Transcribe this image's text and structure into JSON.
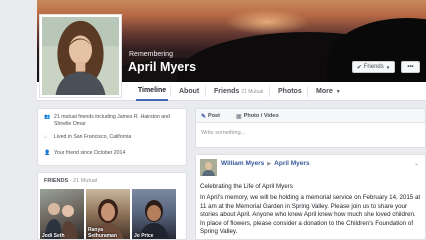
{
  "profile": {
    "remembering": "Remembering",
    "name": "April Myers"
  },
  "actions": {
    "friends_label": "Friends",
    "more_label": "•••"
  },
  "tabs": [
    {
      "label": "Timeline",
      "active": true
    },
    {
      "label": "About"
    },
    {
      "label": "Friends",
      "sub": "21 Mutual"
    },
    {
      "label": "Photos"
    },
    {
      "label": "More"
    }
  ],
  "intro": [
    {
      "icon": "people-icon",
      "text": "21 mutual friends including James R. Hairston and Shirelle Omar"
    },
    {
      "icon": "home-icon",
      "text": "Lived in San Francisco, California"
    },
    {
      "icon": "person-icon",
      "text": "Your friend since October 2014"
    }
  ],
  "friends_box": {
    "title": "FRIENDS",
    "count": "· 21 Mutual",
    "friends": [
      {
        "name": "Jodi Seth"
      },
      {
        "name": "Ranya Sethuraman"
      },
      {
        "name": "Jo Price"
      }
    ]
  },
  "composer": {
    "tab_post": "Post",
    "tab_photo": "Photo / Video",
    "placeholder": "Write something..."
  },
  "post": {
    "author": "William Myers",
    "target": "April Myers",
    "title": "Celebrating the Life of April Myers",
    "body": "In April's memory, we will be holding a memorial service on February 14, 2015 at 11 am at the Memorial Garden in Spring Valley. Please join us to share your stories about April. Anyone who knew April knew how much she loved children. In place of flowers, please consider a donation to the Children's Foundation of Spring Valley."
  },
  "colors": {
    "link": "#365899",
    "accent": "#4267b2",
    "background": "#e9ebee"
  }
}
